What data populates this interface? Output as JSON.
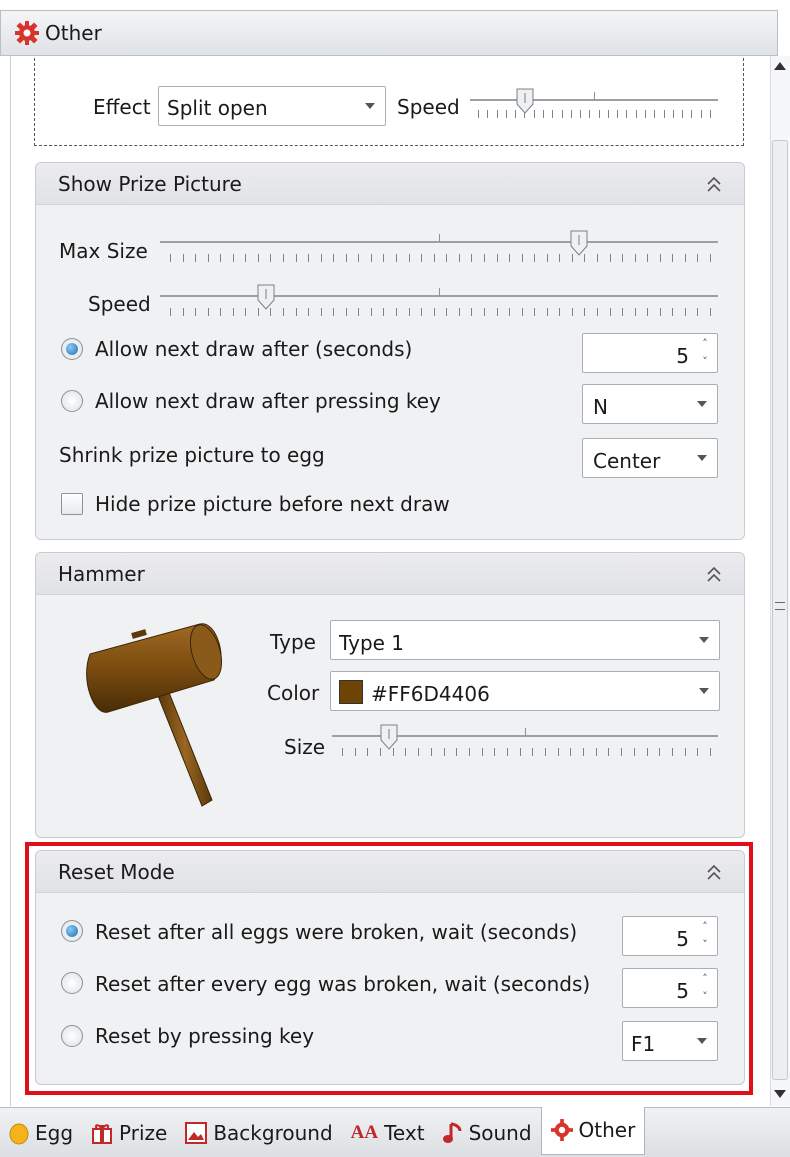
{
  "window": {
    "title": "Other",
    "title_icon": "gear-icon"
  },
  "effect_section": {
    "effect_label": "Effect",
    "effect_value": "Split open",
    "speed_label": "Speed",
    "speed_level": 0.2
  },
  "prize": {
    "title": "Show Prize Picture",
    "max_size_label": "Max Size",
    "max_size_level": 0.76,
    "speed_label": "Speed",
    "speed_level": 0.18,
    "radio_seconds_label": "Allow next draw after (seconds)",
    "seconds_value": "5",
    "radio_key_label": "Allow next draw after pressing key",
    "key_value": "N",
    "shrink_label": "Shrink prize picture to egg",
    "shrink_value": "Center",
    "hide_label": "Hide prize picture before next draw"
  },
  "hammer": {
    "title": "Hammer",
    "type_label": "Type",
    "type_value": "Type 1",
    "color_label": "Color",
    "color_value": "#FF6D4406",
    "color_hex": "#6D4406",
    "size_label": "Size",
    "size_level": 0.13
  },
  "reset": {
    "title": "Reset Mode",
    "opt1_label": "Reset after all eggs were broken, wait (seconds)",
    "opt1_value": "5",
    "opt2_label": "Reset after every egg was broken, wait (seconds)",
    "opt2_value": "5",
    "opt3_label": "Reset by pressing key",
    "opt3_value": "F1"
  },
  "tabs": [
    {
      "label": "Egg",
      "icon": "egg-icon"
    },
    {
      "label": "Prize",
      "icon": "gift-icon"
    },
    {
      "label": "Background",
      "icon": "picture-icon"
    },
    {
      "label": "Text",
      "icon": "text-icon"
    },
    {
      "label": "Sound",
      "icon": "music-note-icon"
    },
    {
      "label": "Other",
      "icon": "gear-icon"
    }
  ],
  "colors": {
    "highlight": "#E0101B",
    "radio_selected": "#1E6FB8"
  }
}
